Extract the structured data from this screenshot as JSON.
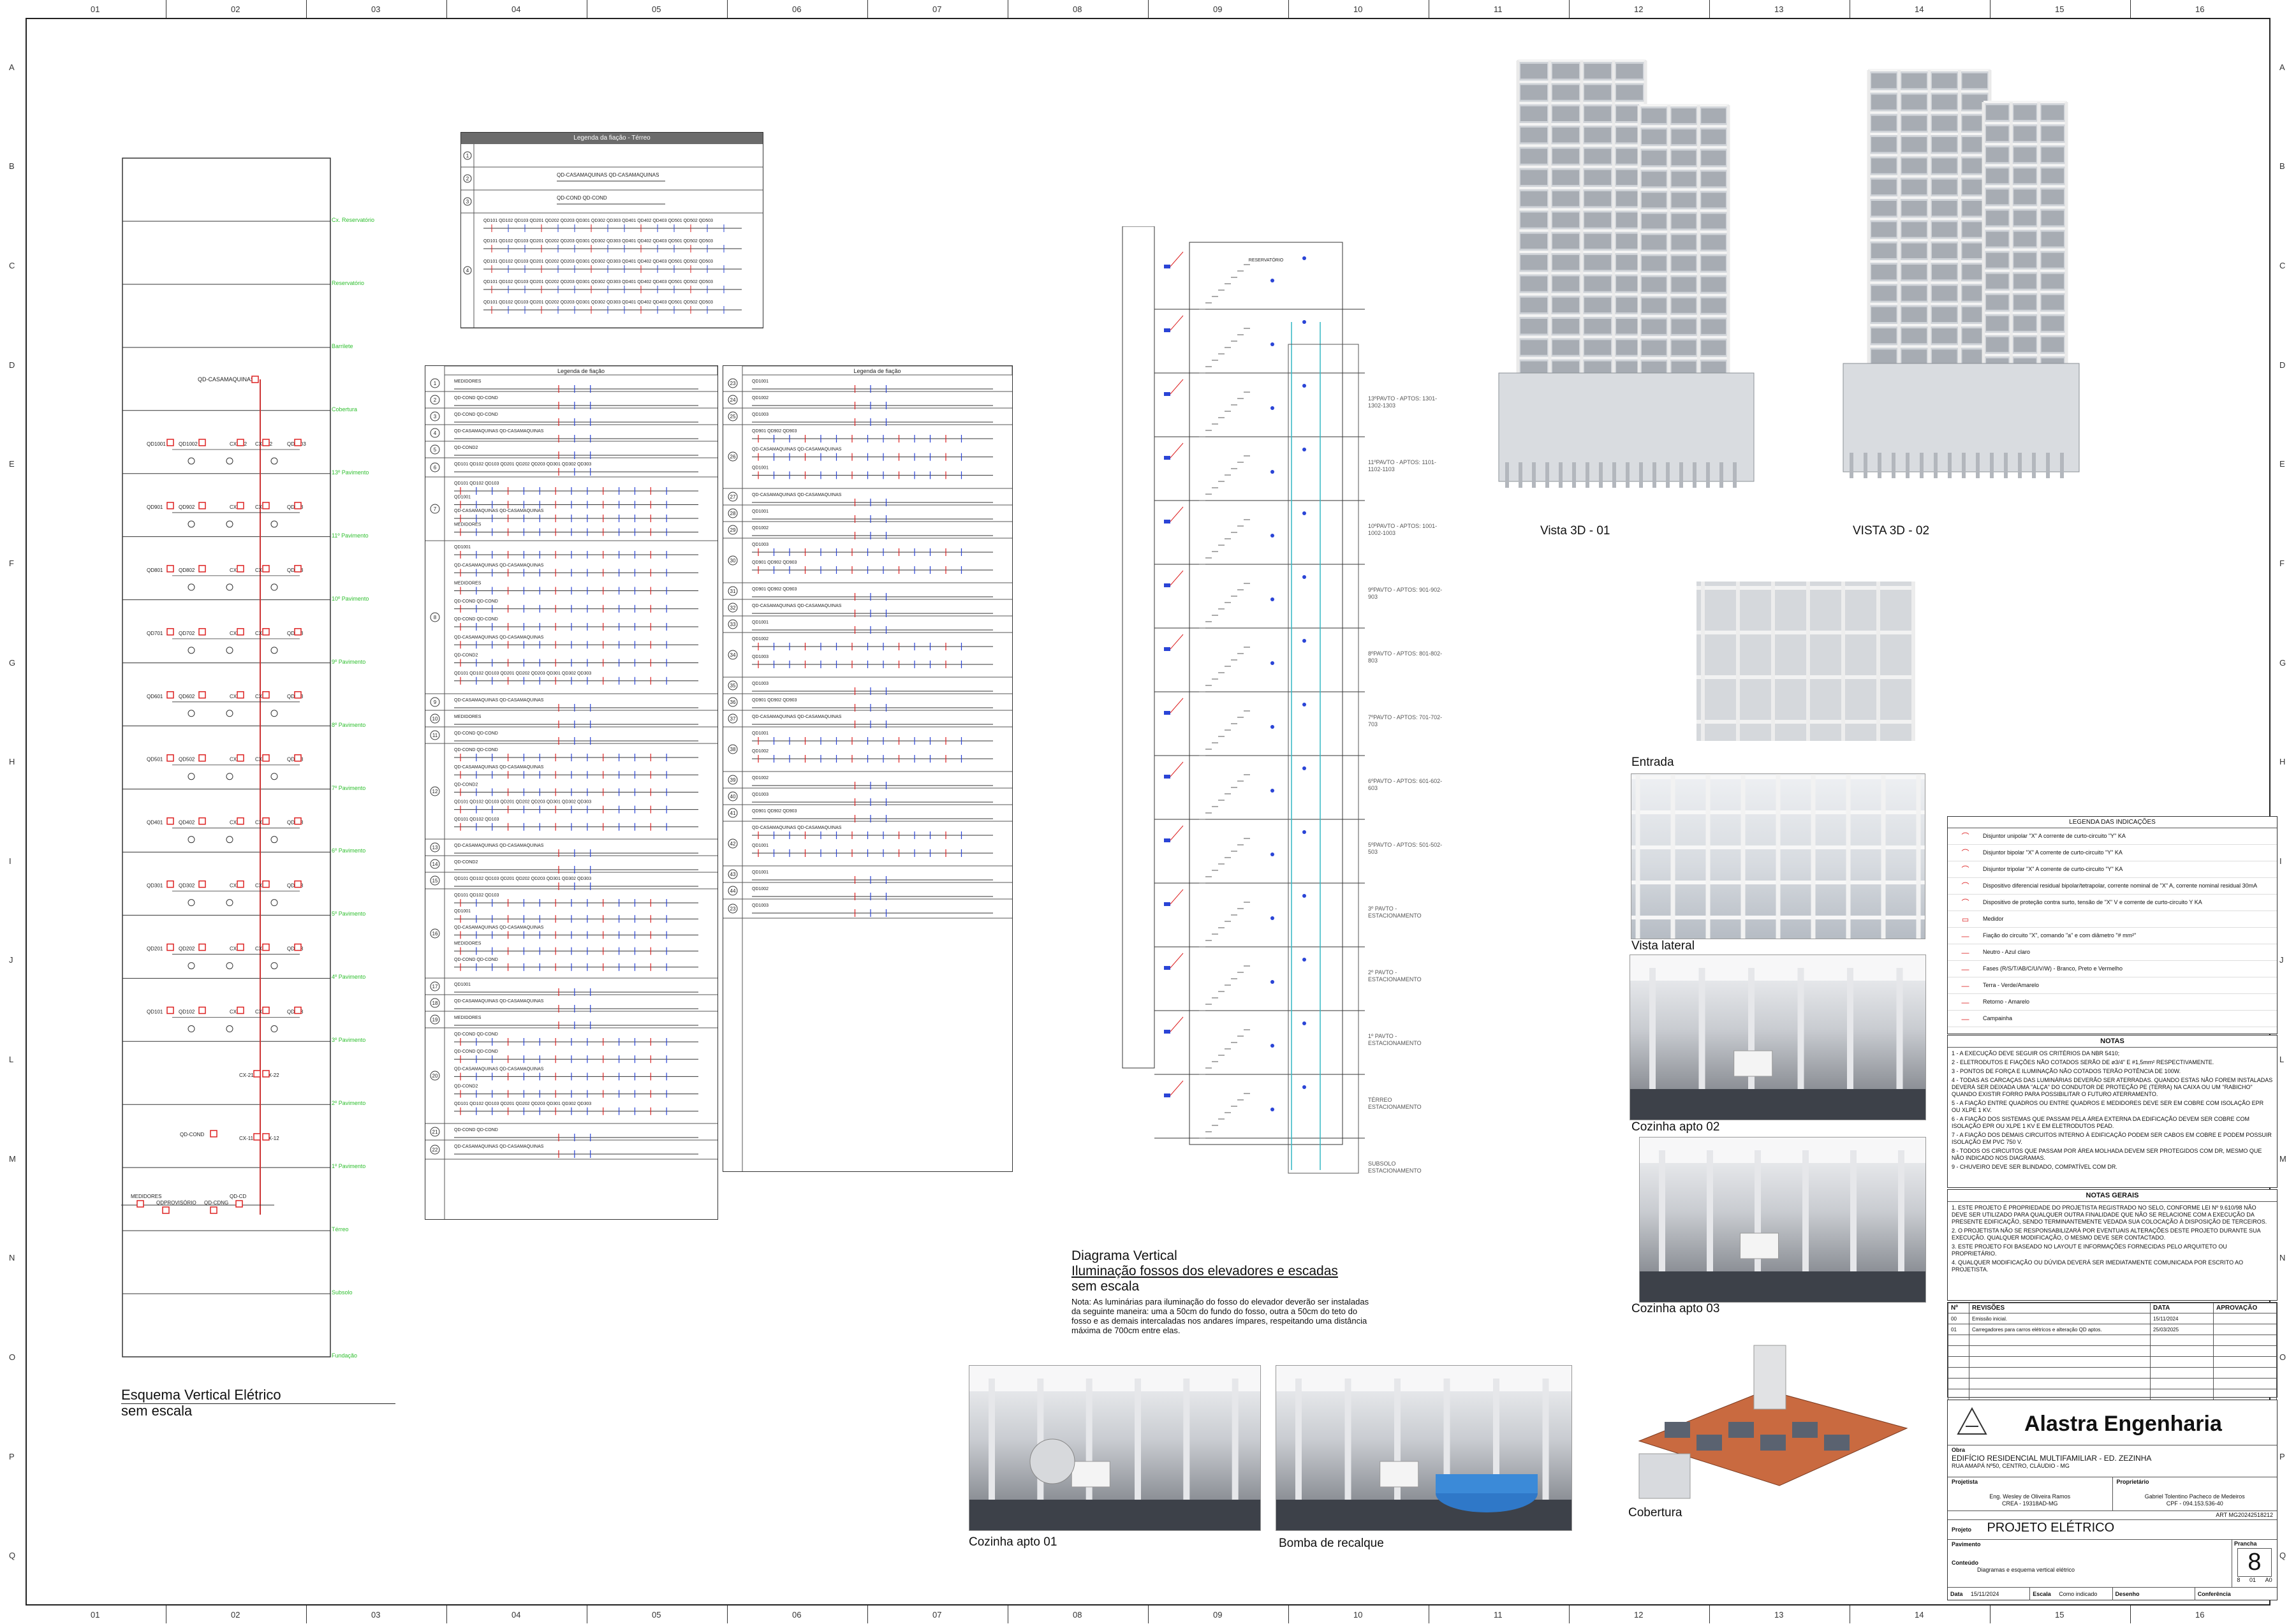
{
  "sheet": {
    "col_numbers": [
      "01",
      "02",
      "03",
      "04",
      "05",
      "06",
      "07",
      "08",
      "09",
      "10",
      "11",
      "12",
      "13",
      "14",
      "15",
      "16"
    ],
    "row_letters": [
      "A",
      "B",
      "C",
      "D",
      "E",
      "F",
      "G",
      "H",
      "I",
      "J",
      "L",
      "M",
      "N",
      "O",
      "P",
      "Q"
    ]
  },
  "vertical_scheme": {
    "title": "Esquema Vertical Elétrico",
    "subtitle": "sem escala",
    "floor_labels": [
      "Cx. Reservatório",
      "Reservatório",
      "Barrilete",
      "Cobertura",
      "13º Pavimento",
      "11º Pavimento",
      "10º Pavimento",
      "9º Pavimento",
      "8º Pavimento",
      "7º Pavimento",
      "6º Pavimento",
      "5º Pavimento",
      "4º Pavimento",
      "3º Pavimento",
      "2º Pavimento",
      "1º Pavimento",
      "Térreo",
      "Subsolo",
      "Fundação"
    ],
    "qd_casamaquinas": "QD-CASAMAQUINAS",
    "row_tags": [
      [
        "QD1001",
        "QD1002",
        "CX-102",
        "CX-102",
        "QD1003"
      ],
      [
        "QD901",
        "QD902",
        "CX-91",
        "CX-92",
        "QD903"
      ],
      [
        "QD801",
        "QD802",
        "CX-81",
        "CX-82",
        "QD803"
      ],
      [
        "QD701",
        "QD702",
        "CX-71",
        "CX-72",
        "QD703"
      ],
      [
        "QD601",
        "QD602",
        "CX-61",
        "CX-62",
        "QD603"
      ],
      [
        "QD501",
        "QD502",
        "CX-51",
        "CX-52",
        "QD503"
      ],
      [
        "QD401",
        "QD402",
        "CX-41",
        "CX-42",
        "QD403"
      ],
      [
        "QD301",
        "QD302",
        "CX-31",
        "CX-32",
        "QD303"
      ],
      [
        "QD201",
        "QD202",
        "CX-21",
        "CX-22",
        "QD203"
      ],
      [
        "QD101",
        "QD102",
        "CX-11",
        "CX-12",
        "QD103"
      ]
    ],
    "cx_lower": [
      "CX-21",
      "CX-22",
      "CX-11",
      "CX-12"
    ],
    "qd_cond": "QD-COND",
    "qd_cond2": "QD-COND2",
    "bottom_tags": [
      "ALIMENTADOR",
      "MEDIDORES",
      "QDPROVISÓRIO",
      "QD-CDNG",
      "QD-CD"
    ]
  },
  "legend_terreo": {
    "title": "Legenda da fiação - Térreo",
    "rows": [
      {
        "n": "1",
        "text": ""
      },
      {
        "n": "2",
        "text": "QD-CASAMAQUINAS  QD-CASAMAQUINAS"
      },
      {
        "n": "3",
        "text": "QD-COND  QD-COND"
      },
      {
        "n": "4",
        "text": "QD101 QD102 QD103 QD201 QD202 QD203 QD301 QD302 QD303 QD401 QD402 QD403 QD501 QD502 QD503"
      }
    ]
  },
  "legend_fiacao_left": {
    "title": "Legenda de fiação",
    "items": [
      "MEDIDORES",
      "QD-COND  QD-COND",
      "QD-COND  QD-COND",
      "QD-CASAMAQUINAS  QD-CASAMAQUINAS",
      "QD-COND2",
      "QD101 QD102 QD103 QD201 QD202 QD203 QD301 QD302 QD303",
      "QD101 QD102 QD103",
      "QD1001",
      "QD-CASAMAQUINAS  QD-CASAMAQUINAS"
    ],
    "numbers": [
      "1",
      "2",
      "3",
      "4",
      "5",
      "6",
      "7",
      "8",
      "9",
      "10",
      "11",
      "12",
      "13",
      "14",
      "15",
      "16",
      "17",
      "18",
      "19",
      "20",
      "21",
      "22"
    ]
  },
  "legend_fiacao_right": {
    "title": "Legenda de fiação",
    "items": [
      "QD1001",
      "QD1002",
      "QD1003",
      "QD901 QD902 QD903",
      "QD-CASAMAQUINAS  QD-CASAMAQUINAS"
    ],
    "numbers": [
      "23",
      "24",
      "25",
      "26",
      "27",
      "28",
      "29",
      "30",
      "31",
      "32",
      "33",
      "34",
      "35",
      "36",
      "37",
      "38",
      "39",
      "40",
      "41",
      "42",
      "43",
      "44"
    ]
  },
  "vertical_diagram": {
    "title": "Diagrama Vertical",
    "subtitle1": "Iluminação fossos dos elevadores e escadas",
    "subtitle2": "sem escala",
    "note": "Nota: As luminárias para iluminação do fosso do elevador deverão ser instaladas da seguinte maneira: uma a 50cm do fundo do fosso, outra a 50cm do teto do fosso e as demais intercaladas nos andares ímpares, respeitando uma distância máxima de 700cm entre elas.",
    "reservatorio": "RESERVATÓRIO",
    "floors": [
      "13ºPAVTO - APTOS: 1301-1302-1303",
      "11ºPAVTO - APTOS: 1101-1102-1103",
      "10ºPAVTO - APTOS: 1001-1002-1003",
      "9ºPAVTO - APTOS: 901-902-903",
      "8ºPAVTO - APTOS: 801-802-803",
      "7ºPAVTO - APTOS: 701-702-703",
      "6ºPAVTO - APTOS: 601-602-603",
      "5ºPAVTO - APTOS: 501-502-503",
      "3º PAVTO - ESTACIONAMENTO",
      "2º PAVTO - ESTACIONAMENTO",
      "1º PAVTO - ESTACIONAMENTO",
      "TÉRREO ESTACIONAMENTO",
      "SUBSOLO ESTACIONAMENTO"
    ]
  },
  "renders": {
    "vista3d01": "Vista 3D - 01",
    "vista3d02": "VISTA 3D - 02",
    "entrada": "Entrada",
    "vista_lateral": "Vista lateral",
    "cozinha02": "Cozinha apto 02",
    "cozinha03": "Cozinha apto 03",
    "cozinha01": "Cozinha apto 01",
    "bomba": "Bomba de recalque",
    "cobertura": "Cobertura"
  },
  "legend_indicacoes": {
    "title": "LEGENDA DAS INDICAÇÕES",
    "items": [
      "Disjuntor unipolar \"X\" A corrente de curto-circuito \"Y\" KA",
      "Disjuntor bipolar \"X\" A corrente de curto-circuito \"Y\" KA",
      "Disjuntor tripolar \"X\" A corrente de curto-circuito \"Y\" KA",
      "Dispositivo diferencial residual bipolar/tetrapolar, corrente nominal de \"X\" A, corrente nominal residual 30mA",
      "Dispositivo de proteção contra surto, tensão de \"X\" V e corrente de curto-circuito Y KA",
      "Medidor",
      "Fiação do circuito \"X\", comando \"a\" e com diâmetro \"# mm²\"",
      "Neutro - Azul claro",
      "Fases (R/S/T/AB/C/U/V/W) - Branco, Preto e Vermelho",
      "Terra - Verde/Amarelo",
      "Retorno - Amarelo",
      "Campainha"
    ]
  },
  "notas": {
    "title": "NOTAS",
    "items": [
      "1 - A EXECUÇÃO DEVE SEGUIR OS CRITÉRIOS DA NBR 5410;",
      "2 - ELETRODUTOS E FIAÇÕES NÃO COTADOS SERÃO DE ø3/4\" E #1,5mm² RESPECTIVAMENTE.",
      "3 - PONTOS DE FORÇA E ILUMINAÇÃO NÃO COTADOS TERÃO POTÊNCIA DE 100W.",
      "4 - TODAS AS CARCAÇAS DAS LUMINÁRIAS DEVERÃO SER ATERRADAS. QUANDO ESTAS NÃO FOREM INSTALADAS DEVERÁ SER DEIXADA UMA \"ALÇA\" DO CONDUTOR DE PROTEÇÃO PE (TERRA) NA CAIXA OU UM \"RABICHO\" QUANDO EXISTIR FORRO PARA POSSIBILITAR O FUTURO ATERRAMENTO.",
      "5 - A FIAÇÃO ENTRE QUADROS OU ENTRE QUADROS E MEDIDORES DEVE SER EM COBRE COM ISOLAÇÃO EPR OU XLPE 1 KV.",
      "6 - A FIAÇÃO DOS SISTEMAS QUE PASSAM PELA ÁREA EXTERNA DA EDIFICAÇÃO DEVEM SER COBRE COM ISOLAÇÃO EPR OU XLPE 1 KV E EM ELETRODUTOS PEAD.",
      "7 - A FIAÇÃO DOS DEMAIS CIRCUITOS INTERNO À EDIFICAÇÃO PODEM SER CABOS EM COBRE E PODEM POSSUIR ISOLAÇÃO EM PVC 750 V.",
      "8 - TODOS OS CIRCUITOS QUE PASSAM POR ÁREA MOLHADA DEVEM SER PROTEGIDOS COM DR, MESMO QUE NÃO INDICADO NOS DIAGRAMAS.",
      "9 - CHUVEIRO DEVE SER BLINDADO, COMPATÍVEL COM DR."
    ]
  },
  "notas_gerais": {
    "title": "NOTAS GERAIS",
    "items": [
      "1. ESTE PROJETO É PROPRIEDADE DO PROJETISTA REGISTRADO NO SELO, CONFORME LEI Nº 9.610/98 NÃO DEVE SER UTILIZADO PARA QUALQUER OUTRA FINALIDADE QUE NÃO SE RELACIONE COM A EXECUÇÃO DA PRESENTE EDIFICAÇÃO, SENDO TERMINANTEMENTE VEDADA SUA COLOCAÇÃO À DISPOSIÇÃO DE TERCEIROS.",
      "2. O PROJETISTA NÃO SE RESPONSABILIZARÁ POR EVENTUAIS ALTERAÇÕES DESTE PROJETO DURANTE SUA EXECUÇÃO. QUALQUER MODIFICAÇÃO, O MESMO DEVE SER CONTACTADO.",
      "3. ESTE PROJETO FOI BASEADO NO LAYOUT E INFORMAÇÕES FORNECIDAS PELO ARQUITETO OU PROPRIETÁRIO.",
      "4. QUALQUER MODIFICAÇÃO OU DÚVIDA DEVERÁ SER IMEDIATAMENTE COMUNICADA POR ESCRITO AO PROJETISTA."
    ]
  },
  "revisions": {
    "headers": [
      "Nº",
      "REVISÕES",
      "DATA",
      "APROVAÇÃO"
    ],
    "rows": [
      [
        "00",
        "Emissão inicial.",
        "15/11/2024",
        ""
      ],
      [
        "01",
        "Carregadores para carros elétricos e alteração QD aptos.",
        "25/03/2025",
        ""
      ]
    ]
  },
  "title_block": {
    "company": "Alastra Engenharia",
    "obra_label": "Obra",
    "obra": "EDIFÍCIO RESIDENCIAL MULTIFAMILIAR - ED. ZEZINHA",
    "address": "RUA AMAPÁ Nº50, CENTRO, CLÁUDIO - MG",
    "proprietario_label": "Proprietário",
    "projetista_label": "Projetista",
    "projetista": "Eng. Wesley de Oliveira Ramos",
    "crea": "CREA - 19318AD-MG",
    "proprietario": "Gabriel Tolentino Pacheco de Medeiros",
    "cpf": "CPF - 094.153.536-40",
    "art": "ART MG20242518212",
    "projeto_label": "Projeto",
    "projeto": "PROJETO ELÉTRICO",
    "pavimento_label": "Pavimento",
    "prancha_label": "Prancha",
    "prancha": "8",
    "conteudo_label": "Conteúdo",
    "conteudo": "Diagramas e esquema vertical elétrico",
    "prancha_total": "8",
    "rev_label": "Rev",
    "rev": "01",
    "formato_label": "Formato",
    "formato": "A0",
    "data_label": "Data",
    "data": "15/11/2024",
    "escala_label": "Escala",
    "escala": "Como indicado",
    "desenho_label": "Desenho",
    "conferencia_label": "Conferência"
  },
  "colors": {
    "green_label": "#2fbf2f",
    "red_symbol": "#d22222",
    "blue_circuit": "#2a44d6",
    "cyan_line": "#34b7c4"
  }
}
